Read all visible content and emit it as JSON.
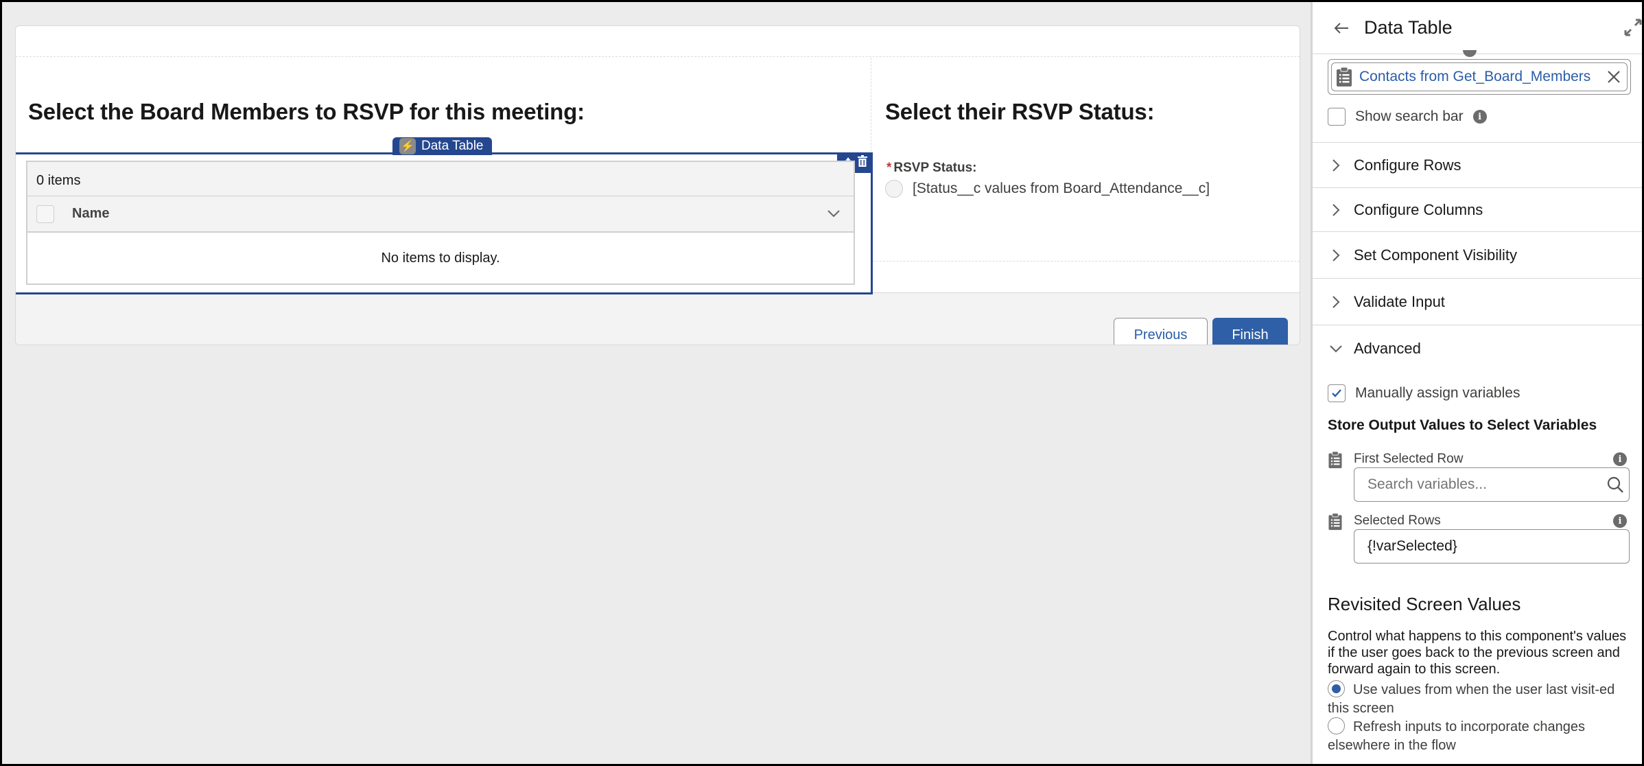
{
  "canvas": {
    "left_section_title": "Select the Board Members to RSVP for this meeting:",
    "right_section_title": "Select their RSVP Status:",
    "data_table": {
      "tag_label": "Data Table",
      "item_count": "0 items",
      "columns": [
        "Name"
      ],
      "empty_message": "No items to display."
    },
    "rsvp": {
      "label": "RSVP Status:",
      "required_marker": "*",
      "option_label": "[Status__c values from Board_Attendance__c]"
    },
    "footer": {
      "previous_label": "Previous",
      "finish_label": "Finish"
    }
  },
  "panel": {
    "title": "Data Table",
    "source_pill": "Contacts from Get_Board_Members",
    "show_search_bar": {
      "label": "Show search bar",
      "checked": false
    },
    "sections": [
      {
        "label": "Configure Rows",
        "expanded": false
      },
      {
        "label": "Configure Columns",
        "expanded": false
      },
      {
        "label": "Set Component Visibility",
        "expanded": false
      },
      {
        "label": "Validate Input",
        "expanded": false
      },
      {
        "label": "Advanced",
        "expanded": true
      }
    ],
    "advanced": {
      "manual_assign": {
        "label": "Manually assign variables",
        "checked": true
      },
      "store_title": "Store Output Values to Select Variables",
      "fields": [
        {
          "label": "First Selected Row",
          "value": "",
          "placeholder": "Search variables..."
        },
        {
          "label": "Selected Rows",
          "value": "{!varSelected}",
          "placeholder": ""
        }
      ],
      "revisit": {
        "title": "Revisited Screen Values",
        "description": "Control what happens to this component's values if the user goes back to the previous screen and forward again to this screen.",
        "options": [
          {
            "label": "Use values from when the user last visit-ed this screen",
            "selected": true
          },
          {
            "label": "Refresh inputs to incorporate changes elsewhere in the flow",
            "selected": false
          }
        ]
      }
    }
  },
  "colors": {
    "selection_blue": "#24478f",
    "brand_blue": "#2f5fa7",
    "link_blue": "#2a5da8",
    "required_red": "#c23934"
  }
}
